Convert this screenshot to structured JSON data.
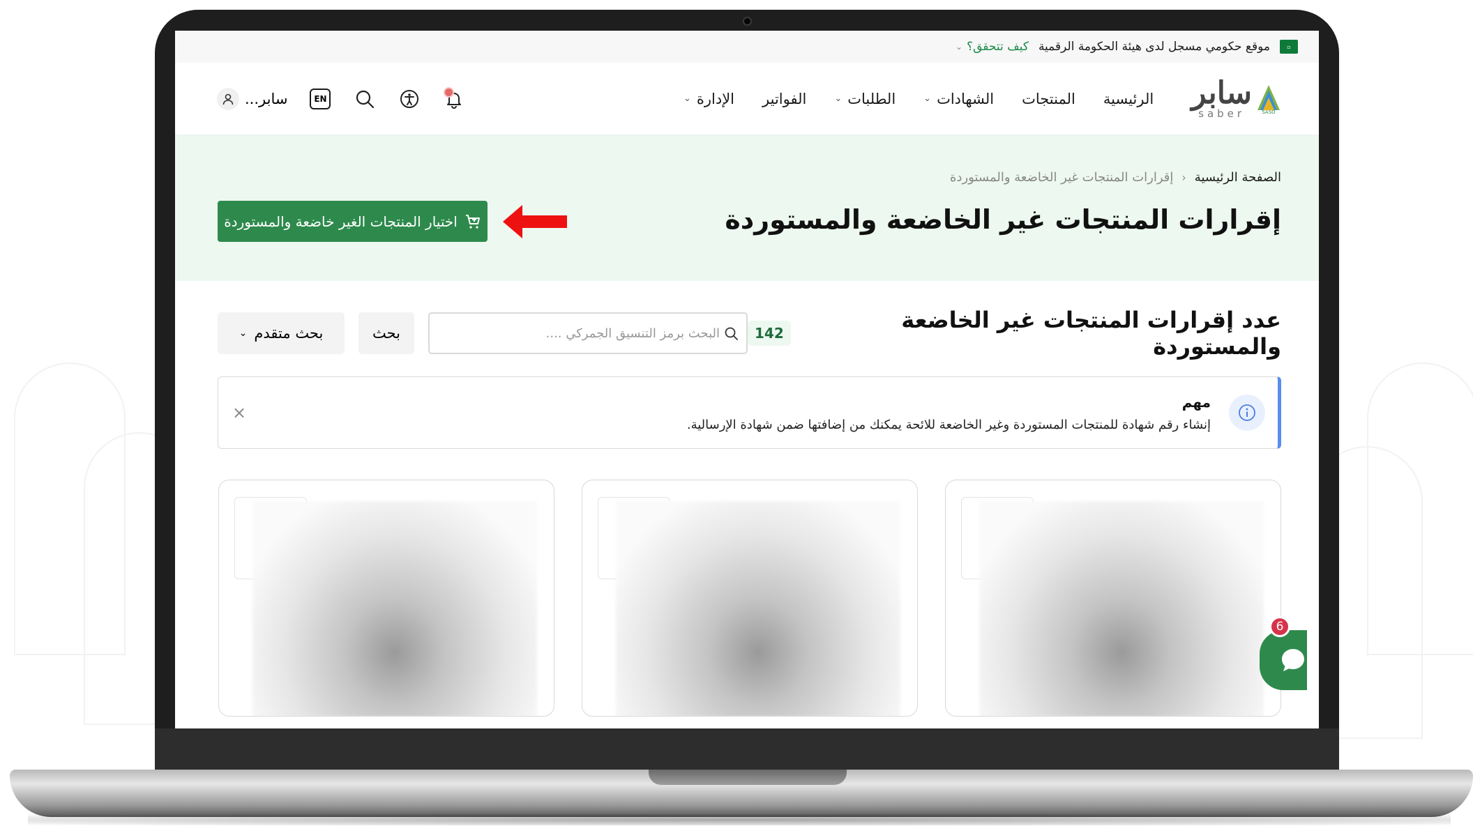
{
  "gov_bar": {
    "text": "موقع حكومي مسجل لدى هيئة الحكومة الرقمية",
    "verify_link": "كيف تتحقق؟"
  },
  "logo": {
    "ar": "سابر",
    "en": "saber"
  },
  "nav": {
    "items": [
      {
        "label": "الرئيسية",
        "dropdown": false
      },
      {
        "label": "المنتجات",
        "dropdown": false
      },
      {
        "label": "الشهادات",
        "dropdown": true
      },
      {
        "label": "الطلبات",
        "dropdown": true
      },
      {
        "label": "الفواتير",
        "dropdown": false
      },
      {
        "label": "الإدارة",
        "dropdown": true
      }
    ],
    "lang_label": "EN",
    "user_name": "سابر..."
  },
  "hero": {
    "breadcrumb_home": "الصفحة الرئيسية",
    "breadcrumb_current": "إقرارات المنتجات غير الخاضعة والمستوردة",
    "title": "إقرارات المنتجات غير الخاضعة والمستوردة",
    "primary_button": "اختيار المنتجات الغير خاضعة والمستوردة"
  },
  "list": {
    "count_title": "عدد إقرارات المنتجات غير الخاضعة والمستوردة",
    "count": "142",
    "search_placeholder": "البحث برمز التنسيق الجمركي ....",
    "search_button": "بحث",
    "advanced_search_button": "بحث متقدم"
  },
  "notice": {
    "title": "مهم",
    "text": "إنشاء رقم شهادة للمنتجات المستوردة وغير الخاضعة للائحة يمكنك من إضافتها ضمن شهادة الإرسالية."
  },
  "chat": {
    "unread": "6"
  },
  "colors": {
    "brand_green": "#2e8a4c",
    "hero_bg": "#edf8f0",
    "notice_accent": "#5b8def",
    "badge_red": "#d6334b"
  }
}
